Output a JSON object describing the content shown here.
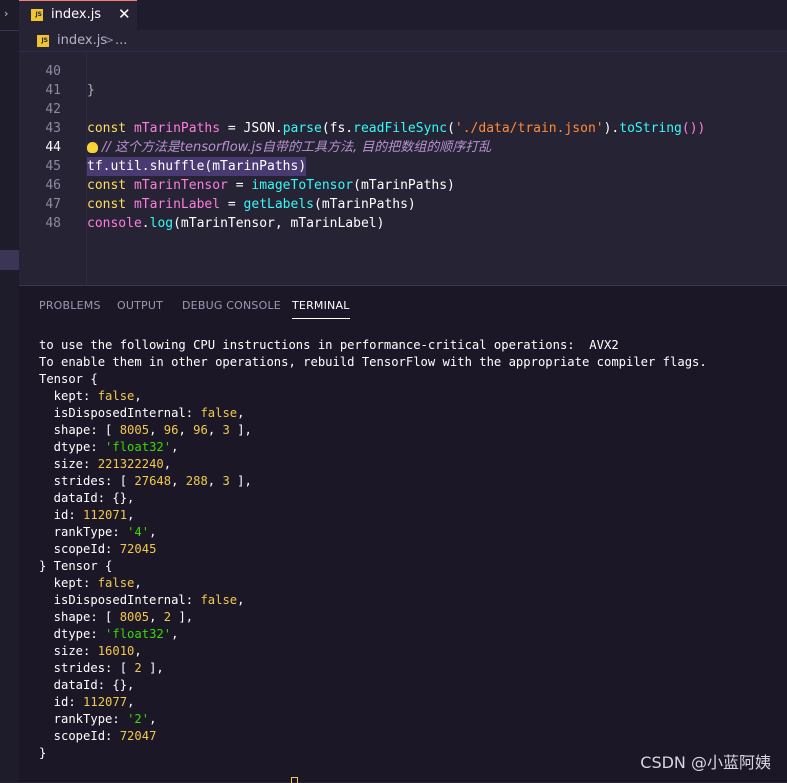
{
  "tab": {
    "icon": "JS",
    "label": "index.js",
    "close": "✕"
  },
  "breadcrumb": {
    "file": "index.js",
    "separator": ">",
    "more": "..."
  },
  "editor": {
    "line40": "40",
    "line41": "41",
    "line42": "42",
    "line43": "43",
    "line44": "44",
    "line45": "45",
    "line46": "46",
    "line47": "47",
    "line48": "48",
    "l40_code": "}",
    "l42": {
      "kw": "const",
      "var": "mTarinPaths",
      "eq": " = ",
      "obj": "JSON",
      "dot1": ".",
      "fn1": "parse",
      "p1": "(fs.",
      "fn2": "readFileSync",
      "p2": "(",
      "str": "'./data/train.json'",
      "p3": ").",
      "fn3": "toString",
      "p4": "())"
    },
    "l43_comment": "// 这个方法是tensorflow.js自带的工具方法, 目的把数组的顺序打乱",
    "l44": {
      "a": "tf.util.shuffle(mTarinPaths)"
    },
    "l45": {
      "kw": "const",
      "var": "mTarinTensor",
      "eq": " = ",
      "fn": "imageToTensor",
      "args": "(mTarinPaths)"
    },
    "l46": {
      "kw": "const",
      "var": "mTarinLabel",
      "eq": " = ",
      "fn": "getLabels",
      "args": "(mTarinPaths)"
    },
    "l47": {
      "obj": "console",
      "dot": ".",
      "fn": "log",
      "args": "(mTarinTensor, mTarinLabel)"
    }
  },
  "panel": {
    "tabs": [
      "PROBLEMS",
      "OUTPUT",
      "DEBUG CONSOLE",
      "TERMINAL"
    ],
    "terminal": {
      "l1": "to use the following CPU instructions in performance-critical operations:  AVX2",
      "l2": "To enable them in other operations, rebuild TensorFlow with the appropriate compiler flags.",
      "l3": "Tensor {",
      "t1": {
        "kept_k": "  kept: ",
        "kept_v": "false",
        "kept_e": ",",
        "disp_k": "  isDisposedInternal: ",
        "disp_v": "false",
        "disp_e": ",",
        "shape_k": "  shape: [ ",
        "shape_v1": "8005",
        "shape_s1": ", ",
        "shape_v2": "96",
        "shape_s2": ", ",
        "shape_v3": "96",
        "shape_s3": ", ",
        "shape_v4": "3",
        "shape_e": " ],",
        "dtype_k": "  dtype: ",
        "dtype_v": "'float32'",
        "dtype_e": ",",
        "size_k": "  size: ",
        "size_v": "221322240",
        "size_e": ",",
        "str_k": "  strides: [ ",
        "str_v1": "27648",
        "str_s1": ", ",
        "str_v2": "288",
        "str_s2": ", ",
        "str_v3": "3",
        "str_e": " ],",
        "data": "  dataId: {},",
        "id_k": "  id: ",
        "id_v": "112071",
        "id_e": ",",
        "rank_k": "  rankType: ",
        "rank_v": "'4'",
        "rank_e": ",",
        "scope_k": "  scopeId: ",
        "scope_v": "72045"
      },
      "mid": "} Tensor {",
      "t2": {
        "kept_k": "  kept: ",
        "kept_v": "false",
        "kept_e": ",",
        "disp_k": "  isDisposedInternal: ",
        "disp_v": "false",
        "disp_e": ",",
        "shape_k": "  shape: [ ",
        "shape_v1": "8005",
        "shape_s1": ", ",
        "shape_v2": "2",
        "shape_e": " ],",
        "dtype_k": "  dtype: ",
        "dtype_v": "'float32'",
        "dtype_e": ",",
        "size_k": "  size: ",
        "size_v": "16010",
        "size_e": ",",
        "str_k": "  strides: [ ",
        "str_v1": "2",
        "str_e": " ],",
        "data": "  dataId: {},",
        "id_k": "  id: ",
        "id_v": "112077",
        "id_e": ",",
        "rank_k": "  rankType: ",
        "rank_v": "'2'",
        "rank_e": ",",
        "scope_k": "  scopeId: ",
        "scope_v": "72047"
      },
      "end": "}"
    }
  },
  "watermark": "CSDN @小蓝阿姨",
  "colors": {
    "accent": "#f97e72",
    "keyword": "#fede5d",
    "string_terminal": "#3ad900",
    "number_terminal": "#f2c94c"
  }
}
